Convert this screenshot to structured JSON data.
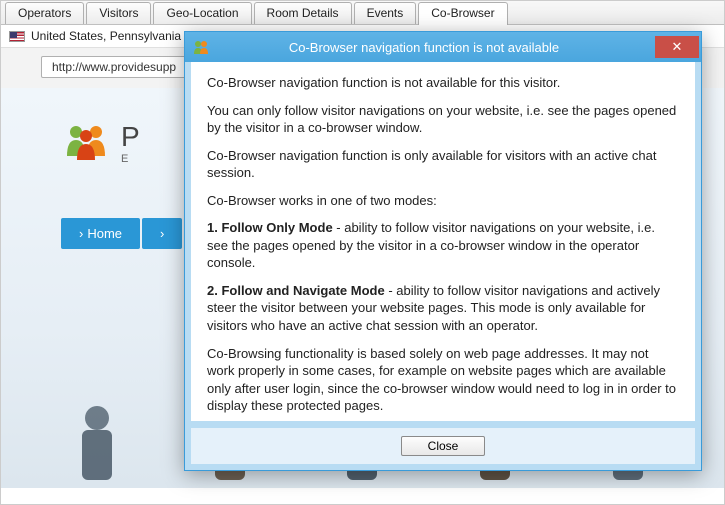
{
  "tabs": {
    "items": [
      {
        "label": "Operators"
      },
      {
        "label": "Visitors"
      },
      {
        "label": "Geo-Location"
      },
      {
        "label": "Room Details"
      },
      {
        "label": "Events"
      },
      {
        "label": "Co-Browser"
      }
    ],
    "active_index": 5
  },
  "location": {
    "text": "United States, Pennsylvania"
  },
  "url_field": "http://www.providesupp",
  "site": {
    "title_visible": "P",
    "subtitle_visible": "E",
    "nav": [
      {
        "label": "Home"
      }
    ]
  },
  "dialog": {
    "title": "Co-Browser navigation function is not available",
    "p1": "Co-Browser navigation function is not available for this visitor.",
    "p2": "You can only follow visitor navigations on your website, i.e. see the pages opened by the visitor in a co-browser window.",
    "p3": "Co-Browser navigation function is only available for visitors with an active chat session.",
    "p4": "Co-Browser works in one of two modes:",
    "mode1_label": "1. Follow Only Mode",
    "mode1_text": " - ability to follow visitor navigations on your website, i.e. see the pages opened by the visitor in a co-browser window in the operator console.",
    "mode2_label": "2. Follow and Navigate Mode",
    "mode2_text": " - ability to follow visitor navigations and actively steer the visitor between your website pages. This mode is only available for visitors who have an active chat session with an operator.",
    "p7": "Co-Browsing functionality is based solely on web page addresses. It may not work properly in some cases, for example on website pages which are available only after user login, since the co-browser window would need to log in in order to display these protected pages.",
    "close_label": "Close"
  }
}
